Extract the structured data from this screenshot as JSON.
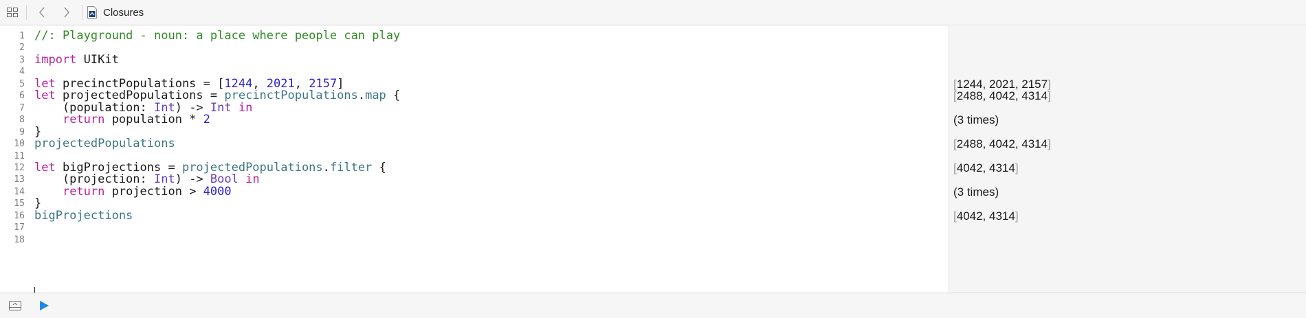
{
  "toolbar": {
    "file_name": "Closures",
    "icons": [
      "grid-icon",
      "chevron-left-icon",
      "chevron-right-icon",
      "swift-file-icon"
    ]
  },
  "editor": {
    "lines": [
      {
        "n": "1",
        "tokens": [
          {
            "t": "//: Playground - noun: a place where people can play",
            "c": "cmt"
          }
        ]
      },
      {
        "n": "2",
        "tokens": []
      },
      {
        "n": "3",
        "tokens": [
          {
            "t": "import",
            "c": "kw"
          },
          {
            "t": " UIKit",
            "c": ""
          }
        ]
      },
      {
        "n": "4",
        "tokens": []
      },
      {
        "n": "5",
        "tokens": [
          {
            "t": "let",
            "c": "kw"
          },
          {
            "t": " precinctPopulations = [",
            "c": ""
          },
          {
            "t": "1244",
            "c": "num"
          },
          {
            "t": ", ",
            "c": ""
          },
          {
            "t": "2021",
            "c": "num"
          },
          {
            "t": ", ",
            "c": ""
          },
          {
            "t": "2157",
            "c": "num"
          },
          {
            "t": "]",
            "c": ""
          }
        ]
      },
      {
        "n": "6",
        "tokens": [
          {
            "t": "let",
            "c": "kw"
          },
          {
            "t": " projectedPopulations = ",
            "c": ""
          },
          {
            "t": "precinctPopulations",
            "c": "var"
          },
          {
            "t": ".",
            "c": ""
          },
          {
            "t": "map",
            "c": "var"
          },
          {
            "t": " {",
            "c": ""
          }
        ]
      },
      {
        "n": "7",
        "tokens": [
          {
            "t": "    (population: ",
            "c": ""
          },
          {
            "t": "Int",
            "c": "ty"
          },
          {
            "t": ") -> ",
            "c": ""
          },
          {
            "t": "Int",
            "c": "ty"
          },
          {
            "t": " ",
            "c": ""
          },
          {
            "t": "in",
            "c": "kw"
          }
        ]
      },
      {
        "n": "8",
        "tokens": [
          {
            "t": "    ",
            "c": ""
          },
          {
            "t": "return",
            "c": "kw"
          },
          {
            "t": " population * ",
            "c": ""
          },
          {
            "t": "2",
            "c": "num"
          }
        ]
      },
      {
        "n": "9",
        "tokens": [
          {
            "t": "}",
            "c": ""
          }
        ]
      },
      {
        "n": "10",
        "tokens": [
          {
            "t": "projectedPopulations",
            "c": "var"
          }
        ]
      },
      {
        "n": "11",
        "tokens": []
      },
      {
        "n": "12",
        "tokens": [
          {
            "t": "let",
            "c": "kw"
          },
          {
            "t": " bigProjections = ",
            "c": ""
          },
          {
            "t": "projectedPopulations",
            "c": "var"
          },
          {
            "t": ".",
            "c": ""
          },
          {
            "t": "filter",
            "c": "var"
          },
          {
            "t": " {",
            "c": ""
          }
        ]
      },
      {
        "n": "13",
        "tokens": [
          {
            "t": "    (projection: ",
            "c": ""
          },
          {
            "t": "Int",
            "c": "ty"
          },
          {
            "t": ") -> ",
            "c": ""
          },
          {
            "t": "Bool",
            "c": "ty"
          },
          {
            "t": " ",
            "c": ""
          },
          {
            "t": "in",
            "c": "kw"
          }
        ]
      },
      {
        "n": "14",
        "tokens": [
          {
            "t": "    ",
            "c": ""
          },
          {
            "t": "return",
            "c": "kw"
          },
          {
            "t": " projection > ",
            "c": ""
          },
          {
            "t": "4000",
            "c": "num"
          }
        ]
      },
      {
        "n": "15",
        "tokens": [
          {
            "t": "}",
            "c": ""
          }
        ]
      },
      {
        "n": "16",
        "tokens": [
          {
            "t": "bigProjections",
            "c": "var"
          }
        ]
      },
      {
        "n": "17",
        "tokens": []
      },
      {
        "n": "18",
        "tokens": []
      }
    ]
  },
  "results": [
    {
      "line": 5,
      "parts": [
        {
          "t": "[",
          "b": true
        },
        {
          "t": "1244, 2021, 2157",
          "b": false
        },
        {
          "t": "]",
          "b": true
        }
      ]
    },
    {
      "line": 6,
      "parts": [
        {
          "t": "[",
          "b": true
        },
        {
          "t": "2488, 4042, 4314",
          "b": false
        },
        {
          "t": "]",
          "b": true
        }
      ]
    },
    {
      "line": 8,
      "parts": [
        {
          "t": "(3 times)",
          "b": false
        }
      ]
    },
    {
      "line": 10,
      "parts": [
        {
          "t": "[",
          "b": true
        },
        {
          "t": "2488, 4042, 4314",
          "b": false
        },
        {
          "t": "]",
          "b": true
        }
      ]
    },
    {
      "line": 12,
      "parts": [
        {
          "t": "[",
          "b": true
        },
        {
          "t": "4042, 4314",
          "b": false
        },
        {
          "t": "]",
          "b": true
        }
      ]
    },
    {
      "line": 14,
      "parts": [
        {
          "t": "(3 times)",
          "b": false
        }
      ]
    },
    {
      "line": 16,
      "parts": [
        {
          "t": "[",
          "b": true
        },
        {
          "t": "4042, 4314",
          "b": false
        },
        {
          "t": "]",
          "b": true
        }
      ]
    }
  ],
  "bottombar": {
    "icons": [
      "debug-area-toggle-icon",
      "run-play-icon"
    ],
    "run_color": "#1e88e5"
  }
}
